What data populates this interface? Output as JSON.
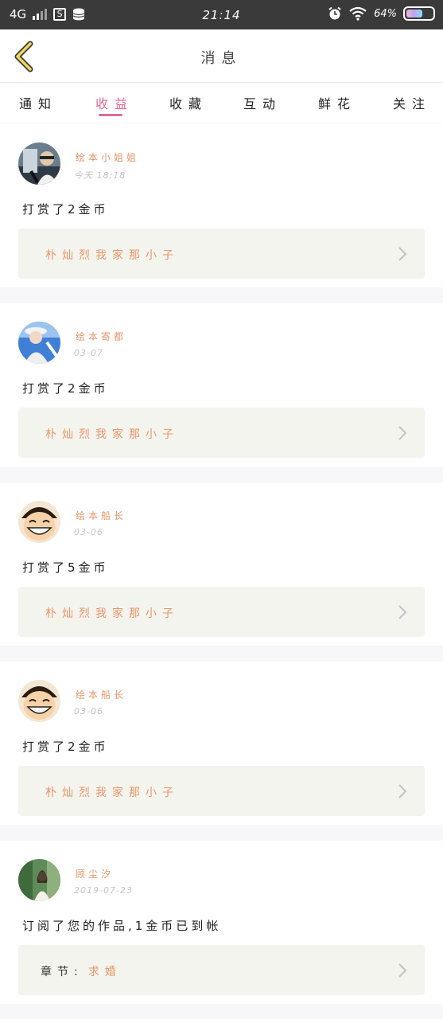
{
  "status_bar": {
    "network": "4G",
    "storage_badge": "S",
    "time": "21:14",
    "battery_text": "64%",
    "battery_level": 0.64
  },
  "header": {
    "title": "消息"
  },
  "tabs": [
    {
      "label": "通知",
      "active": false
    },
    {
      "label": "收益",
      "active": true
    },
    {
      "label": "收藏",
      "active": false
    },
    {
      "label": "互动",
      "active": false
    },
    {
      "label": "鲜花",
      "active": false
    },
    {
      "label": "关注",
      "active": false
    }
  ],
  "colors": {
    "accent": "#e06a9e",
    "name_orange": "#e9966a",
    "card_bg": "#f4f4ee",
    "page_bg": "#f7f6f8"
  },
  "messages": [
    {
      "avatar": "avatar-man-car",
      "name": "绘本小姐姐",
      "date": "今天 18:18",
      "action": "打赏了2金币",
      "target_prefix": "",
      "target": "朴灿烈我家那小子"
    },
    {
      "avatar": "avatar-girl-hat",
      "name": "绘本寄都",
      "date": "03-07",
      "action": "打赏了2金币",
      "target_prefix": "",
      "target": "朴灿烈我家那小子"
    },
    {
      "avatar": "avatar-luffy",
      "name": "绘本船长",
      "date": "03-06",
      "action": "打赏了5金币",
      "target_prefix": "",
      "target": "朴灿烈我家那小子"
    },
    {
      "avatar": "avatar-luffy",
      "name": "绘本船长",
      "date": "03-06",
      "action": "打赏了2金币",
      "target_prefix": "",
      "target": "朴灿烈我家那小子"
    },
    {
      "avatar": "avatar-girl-green",
      "name": "顾尘汐",
      "date": "2019-07-23",
      "action": "订阅了您的作品,1金币已到帐",
      "target_prefix": "章节:",
      "target": "求婚"
    }
  ]
}
